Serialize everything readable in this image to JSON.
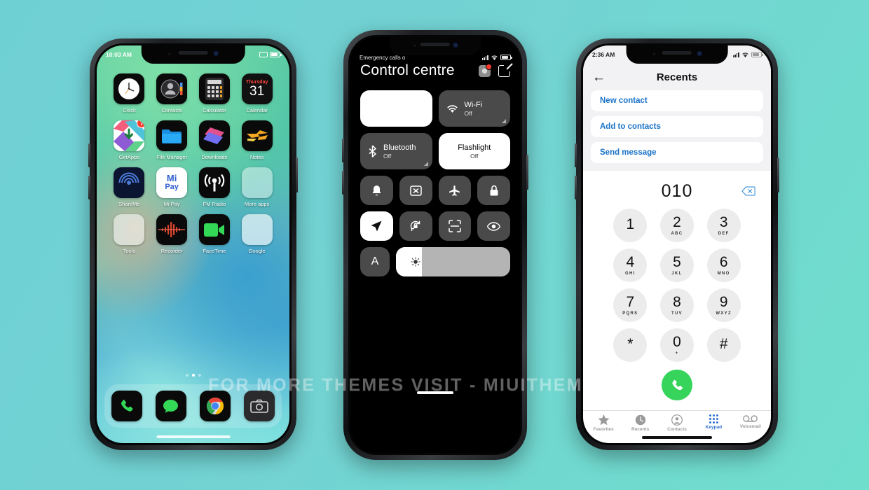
{
  "background": {
    "color_start": "#6fd0d4",
    "color_end": "#6fdecd"
  },
  "watermark": {
    "text": "FOR MORE THEMES VISIT - MIUITHEMEZ.COM"
  },
  "phone_home": {
    "status": {
      "time": "10:03 AM",
      "icons": [
        "screenshot-icon",
        "battery-icon"
      ]
    },
    "apps": [
      {
        "label": "Clock",
        "icon": "clock-icon"
      },
      {
        "label": "Contacts",
        "icon": "contacts-icon"
      },
      {
        "label": "Calculator",
        "icon": "calculator-icon"
      },
      {
        "label": "Calendar",
        "icon": "calendar-icon",
        "weekday": "Thursday",
        "day": "31"
      },
      {
        "label": "GetApps",
        "icon": "getapps-icon",
        "badge": "7"
      },
      {
        "label": "File Manager",
        "icon": "file-manager-icon"
      },
      {
        "label": "Downloads",
        "icon": "downloads-icon"
      },
      {
        "label": "Notes",
        "icon": "notes-icon"
      },
      {
        "label": "ShareMe",
        "icon": "shareme-icon"
      },
      {
        "label": "Mi Pay",
        "icon": "mipay-icon"
      },
      {
        "label": "FM Radio",
        "icon": "fm-radio-icon"
      },
      {
        "label": "More apps",
        "icon": "folder-icon"
      },
      {
        "label": "Tools",
        "icon": "tools-folder-icon"
      },
      {
        "label": "Recorder",
        "icon": "recorder-icon"
      },
      {
        "label": "FaceTime",
        "icon": "facetime-icon"
      },
      {
        "label": "Google",
        "icon": "google-folder-icon"
      }
    ],
    "page_dots": {
      "count": 3,
      "active_index": 1
    },
    "dock": [
      {
        "label": "Phone",
        "icon": "phone-icon"
      },
      {
        "label": "Messages",
        "icon": "messages-icon"
      },
      {
        "label": "Chrome",
        "icon": "chrome-icon"
      },
      {
        "label": "Camera",
        "icon": "camera-icon"
      }
    ]
  },
  "phone_control_centre": {
    "status": {
      "carrier": "Emergency calls o",
      "icons": [
        "signal-icon",
        "wifi-icon",
        "battery-icon"
      ]
    },
    "title": "Control centre",
    "header_actions": [
      {
        "name": "settings-gear",
        "badge": true
      },
      {
        "name": "edit-pencil"
      }
    ],
    "tiles": [
      {
        "name": "",
        "state": "",
        "active": true,
        "blank": true
      },
      {
        "name": "Wi-Fi",
        "state": "Off",
        "active": false,
        "icon": "wifi-icon",
        "expandable": true
      },
      {
        "name": "Bluetooth",
        "state": "Off",
        "active": false,
        "icon": "bluetooth-icon",
        "expandable": true
      },
      {
        "name": "Flashlight",
        "state": "Off",
        "active": true,
        "icon": "",
        "centered": true
      }
    ],
    "toggles_row1": [
      {
        "icon": "bell-icon",
        "active": false
      },
      {
        "icon": "cast-icon",
        "active": false
      },
      {
        "icon": "airplane-icon",
        "active": false
      },
      {
        "icon": "lock-icon",
        "active": false
      }
    ],
    "toggles_row2": [
      {
        "icon": "location-arrow-icon",
        "active": true
      },
      {
        "icon": "rotation-lock-icon",
        "active": false
      },
      {
        "icon": "scan-icon",
        "active": false
      },
      {
        "icon": "eye-icon",
        "active": false
      }
    ],
    "last_row": {
      "font_button": "A",
      "brightness_percent": 23,
      "slider_icon": "brightness-icon"
    }
  },
  "phone_dialer": {
    "status": {
      "time": "2:36 AM",
      "icons": [
        "signal-icon",
        "wifi-icon",
        "battery-icon"
      ]
    },
    "nav": {
      "back_icon": "back-arrow-icon",
      "title": "Recents"
    },
    "actions": [
      "New contact",
      "Add to contacts",
      "Send message"
    ],
    "display": {
      "number": "010",
      "delete_icon": "backspace-icon"
    },
    "keys": [
      {
        "digit": "1",
        "letters": ""
      },
      {
        "digit": "2",
        "letters": "ABC"
      },
      {
        "digit": "3",
        "letters": "DEF"
      },
      {
        "digit": "4",
        "letters": "GHI"
      },
      {
        "digit": "5",
        "letters": "JKL"
      },
      {
        "digit": "6",
        "letters": "MNO"
      },
      {
        "digit": "7",
        "letters": "PQRS"
      },
      {
        "digit": "8",
        "letters": "TUV"
      },
      {
        "digit": "9",
        "letters": "WXYZ"
      },
      {
        "digit": "*",
        "letters": ""
      },
      {
        "digit": "0",
        "letters": "+"
      },
      {
        "digit": "#",
        "letters": ""
      }
    ],
    "call_button": {
      "icon": "phone-icon",
      "color": "#37d45c"
    },
    "tabs": [
      {
        "label": "Favorites",
        "icon": "star-icon",
        "active": false
      },
      {
        "label": "Recents",
        "icon": "clock-icon",
        "active": false
      },
      {
        "label": "Contacts",
        "icon": "person-circle-icon",
        "active": false
      },
      {
        "label": "Keypad",
        "icon": "keypad-icon",
        "active": true
      },
      {
        "label": "Voicemail",
        "icon": "voicemail-icon",
        "active": false
      }
    ]
  }
}
